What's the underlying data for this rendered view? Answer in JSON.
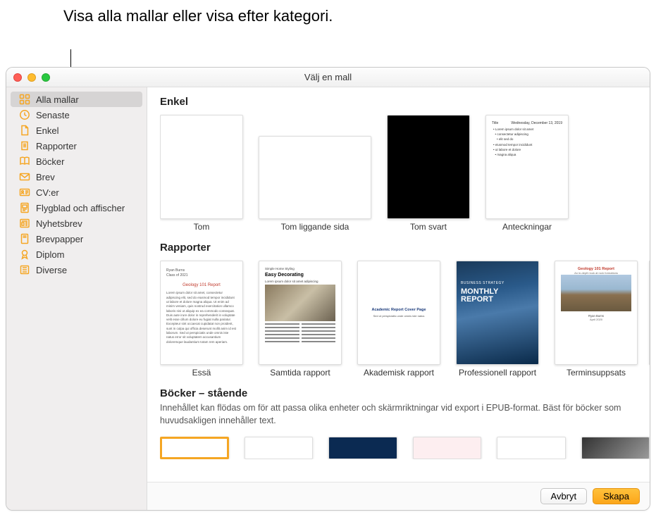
{
  "callout": "Visa alla mallar eller visa efter kategori.",
  "window": {
    "title": "Välj en mall"
  },
  "sidebar": {
    "items": [
      {
        "label": "Alla mallar",
        "icon": "grid-icon",
        "selected": true
      },
      {
        "label": "Senaste",
        "icon": "clock-icon",
        "selected": false
      },
      {
        "label": "Enkel",
        "icon": "document-icon",
        "selected": false
      },
      {
        "label": "Rapporter",
        "icon": "document-stack-icon",
        "selected": false
      },
      {
        "label": "Böcker",
        "icon": "book-icon",
        "selected": false
      },
      {
        "label": "Brev",
        "icon": "envelope-icon",
        "selected": false
      },
      {
        "label": "CV:er",
        "icon": "id-card-icon",
        "selected": false
      },
      {
        "label": "Flygblad och affischer",
        "icon": "poster-icon",
        "selected": false
      },
      {
        "label": "Nyhetsbrev",
        "icon": "newspaper-icon",
        "selected": false
      },
      {
        "label": "Brevpapper",
        "icon": "letterhead-icon",
        "selected": false
      },
      {
        "label": "Diplom",
        "icon": "ribbon-icon",
        "selected": false
      },
      {
        "label": "Diverse",
        "icon": "folder-icon",
        "selected": false
      }
    ]
  },
  "sections": {
    "enkel": {
      "title": "Enkel",
      "templates": [
        {
          "label": "Tom"
        },
        {
          "label": "Tom liggande sida"
        },
        {
          "label": "Tom svart"
        },
        {
          "label": "Anteckningar"
        }
      ]
    },
    "rapporter": {
      "title": "Rapporter",
      "templates": [
        {
          "label": "Essä"
        },
        {
          "label": "Samtida rapport"
        },
        {
          "label": "Akademisk rapport"
        },
        {
          "label": "Professionell rapport"
        },
        {
          "label": "Terminsuppsats"
        }
      ]
    },
    "bocker": {
      "title": "Böcker – stående",
      "description": "Innehållet kan flödas om för att passa olika enheter och skärmriktningar vid export i EPUB-format. Bäst för böcker som huvudsakligen innehåller text."
    }
  },
  "thumb_text": {
    "anteckn_title": "Title",
    "anteckn_date": "Wednesday, December 13, 2019",
    "essay_author": "Ryan Burns",
    "essay_title": "Geology 101 Report",
    "decor_sub": "Simple Home Styling",
    "decor_big": "Easy Decorating",
    "acad_title": "Academic Report Cover Page",
    "acad_sub": "Sed ut perspiciatis unde omnis iste natus",
    "prof_sub": "BUSINESS STRATEGY",
    "prof_big1": "MONTHLY",
    "prof_big2": "REPORT",
    "term_title": "Geology 101 Report",
    "term_auth": "Ryan Burns"
  },
  "footer": {
    "cancel": "Avbryt",
    "create": "Skapa"
  },
  "colors": {
    "accent": "#f5a623",
    "sidebar_icon": "#f5a623"
  }
}
